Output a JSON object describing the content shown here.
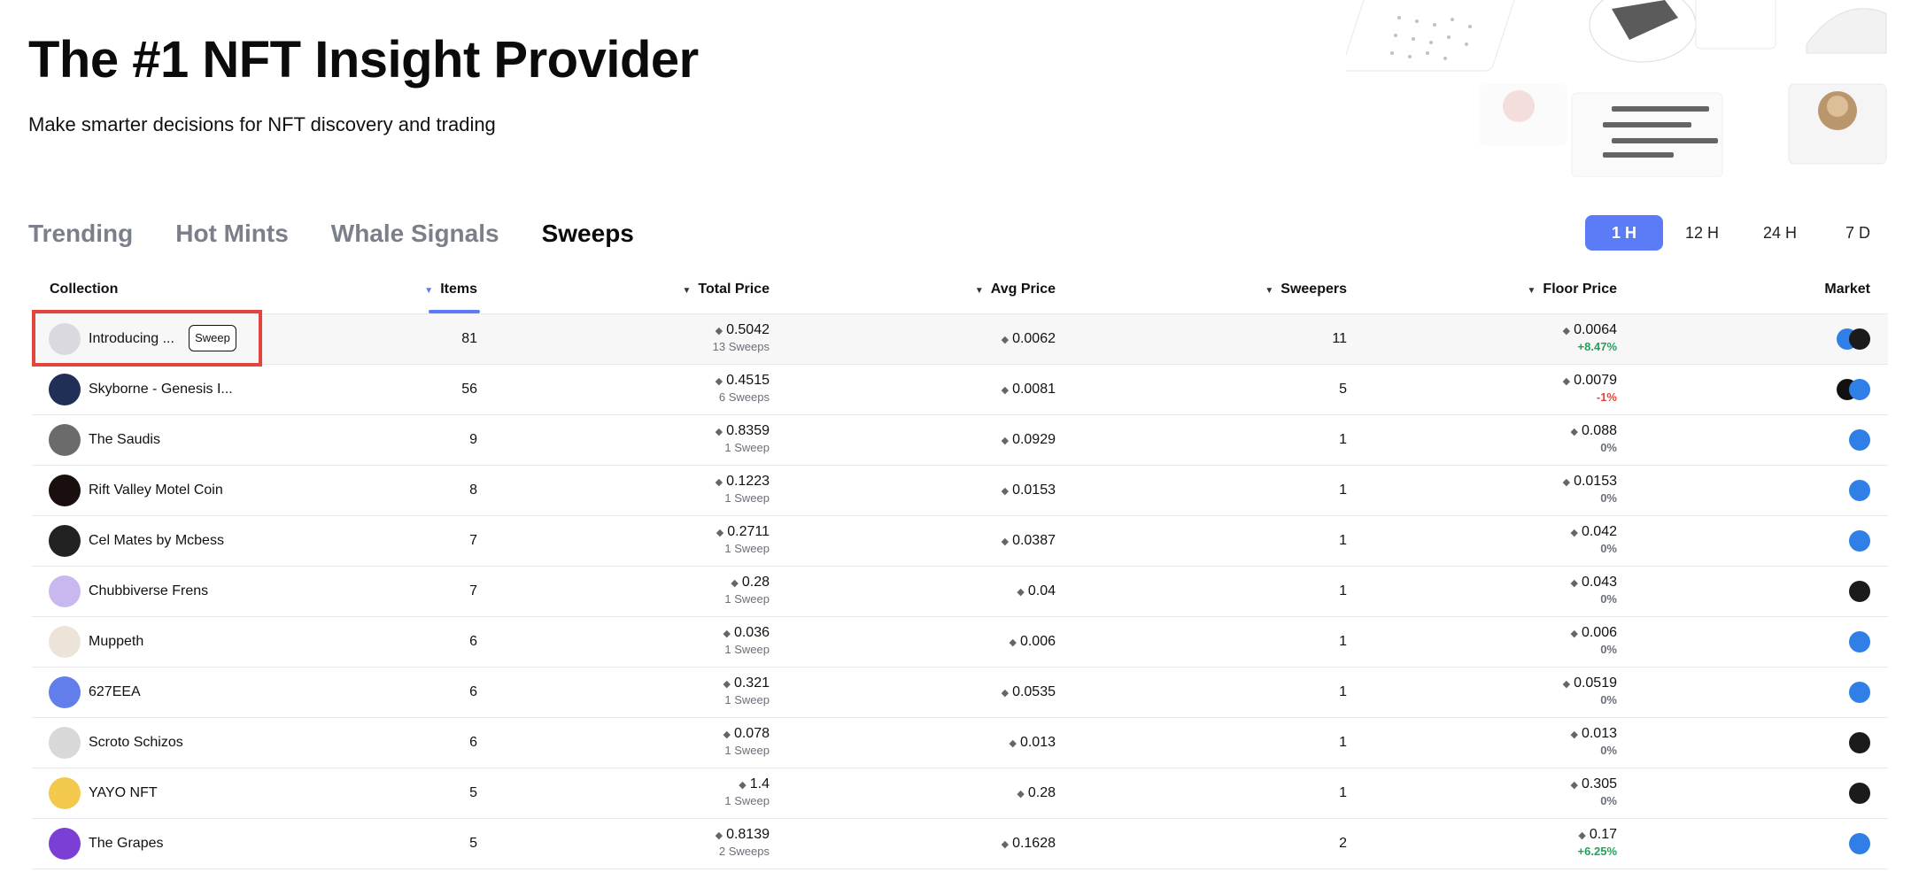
{
  "hero": {
    "title": "The #1 NFT Insight Provider",
    "subtitle": "Make smarter decisions for NFT discovery and trading"
  },
  "tabs": [
    {
      "label": "Trending",
      "active": false
    },
    {
      "label": "Hot Mints",
      "active": false
    },
    {
      "label": "Whale Signals",
      "active": false
    },
    {
      "label": "Sweeps",
      "active": true
    }
  ],
  "time_range": [
    {
      "label": "1 H",
      "active": true
    },
    {
      "label": "12 H",
      "active": false
    },
    {
      "label": "24 H",
      "active": false
    },
    {
      "label": "7 D",
      "active": false
    }
  ],
  "table": {
    "headers": {
      "collection": "Collection",
      "items": "Items",
      "total_price": "Total Price",
      "avg_price": "Avg Price",
      "sweepers": "Sweepers",
      "floor_price": "Floor Price",
      "market": "Market"
    },
    "sweep_button_label": "Sweep",
    "rows": [
      {
        "name": "Introducing ...",
        "items": "81",
        "total": "0.5042",
        "sweeps": "13 Sweeps",
        "avg": "0.0062",
        "sweepers": "11",
        "floor": "0.0064",
        "change": "+8.47%",
        "change_type": "pos",
        "avatar_color": "#d9d9df",
        "markets": [
          "blue-icon",
          "black-icon"
        ]
      },
      {
        "name": "Skyborne - Genesis I...",
        "items": "56",
        "total": "0.4515",
        "sweeps": "6 Sweeps",
        "avg": "0.0081",
        "sweepers": "5",
        "floor": "0.0079",
        "change": "-1%",
        "change_type": "neg",
        "avatar_color": "#1f2f55",
        "markets": [
          "green-icon",
          "blue-icon"
        ]
      },
      {
        "name": "The Saudis",
        "items": "9",
        "total": "0.8359",
        "sweeps": "1 Sweep",
        "avg": "0.0929",
        "sweepers": "1",
        "floor": "0.088",
        "change": "0%",
        "change_type": "zero",
        "avatar_color": "#6b6b6b",
        "markets": [
          "blue-icon"
        ]
      },
      {
        "name": "Rift Valley Motel Coin",
        "items": "8",
        "total": "0.1223",
        "sweeps": "1 Sweep",
        "avg": "0.0153",
        "sweepers": "1",
        "floor": "0.0153",
        "change": "0%",
        "change_type": "zero",
        "avatar_color": "#1a0f0f",
        "markets": [
          "blue-icon"
        ]
      },
      {
        "name": "Cel Mates by Mcbess",
        "items": "7",
        "total": "0.2711",
        "sweeps": "1 Sweep",
        "avg": "0.0387",
        "sweepers": "1",
        "floor": "0.042",
        "change": "0%",
        "change_type": "zero",
        "avatar_color": "#222222",
        "markets": [
          "blue-icon"
        ]
      },
      {
        "name": "Chubbiverse Frens",
        "items": "7",
        "total": "0.28",
        "sweeps": "1 Sweep",
        "avg": "0.04",
        "sweepers": "1",
        "floor": "0.043",
        "change": "0%",
        "change_type": "zero",
        "avatar_color": "#c9b8f0",
        "markets": [
          "black-icon"
        ]
      },
      {
        "name": "Muppeth",
        "items": "6",
        "total": "0.036",
        "sweeps": "1 Sweep",
        "avg": "0.006",
        "sweepers": "1",
        "floor": "0.006",
        "change": "0%",
        "change_type": "zero",
        "avatar_color": "#ece4d8",
        "markets": [
          "blue-icon"
        ]
      },
      {
        "name": "627EEA",
        "items": "6",
        "total": "0.321",
        "sweeps": "1 Sweep",
        "avg": "0.0535",
        "sweepers": "1",
        "floor": "0.0519",
        "change": "0%",
        "change_type": "zero",
        "avatar_color": "#627EEA",
        "markets": [
          "blue-icon"
        ]
      },
      {
        "name": "Scroto Schizos",
        "items": "6",
        "total": "0.078",
        "sweeps": "1 Sweep",
        "avg": "0.013",
        "sweepers": "1",
        "floor": "0.013",
        "change": "0%",
        "change_type": "zero",
        "avatar_color": "#d8d8d8",
        "markets": [
          "black-icon"
        ]
      },
      {
        "name": "YAYO NFT",
        "items": "5",
        "total": "1.4",
        "sweeps": "1 Sweep",
        "avg": "0.28",
        "sweepers": "1",
        "floor": "0.305",
        "change": "0%",
        "change_type": "zero",
        "avatar_color": "#f2c94c",
        "markets": [
          "black-icon"
        ]
      },
      {
        "name": "The Grapes",
        "items": "5",
        "total": "0.8139",
        "sweeps": "2 Sweeps",
        "avg": "0.1628",
        "sweepers": "2",
        "floor": "0.17",
        "change": "+6.25%",
        "change_type": "pos",
        "avatar_color": "#7b3fd6",
        "markets": [
          "blue-icon"
        ]
      }
    ]
  },
  "colors": {
    "accent": "#5b7cf6",
    "positive": "#22a35b",
    "negative": "#e2453d",
    "highlight_box": "#e2453d"
  }
}
